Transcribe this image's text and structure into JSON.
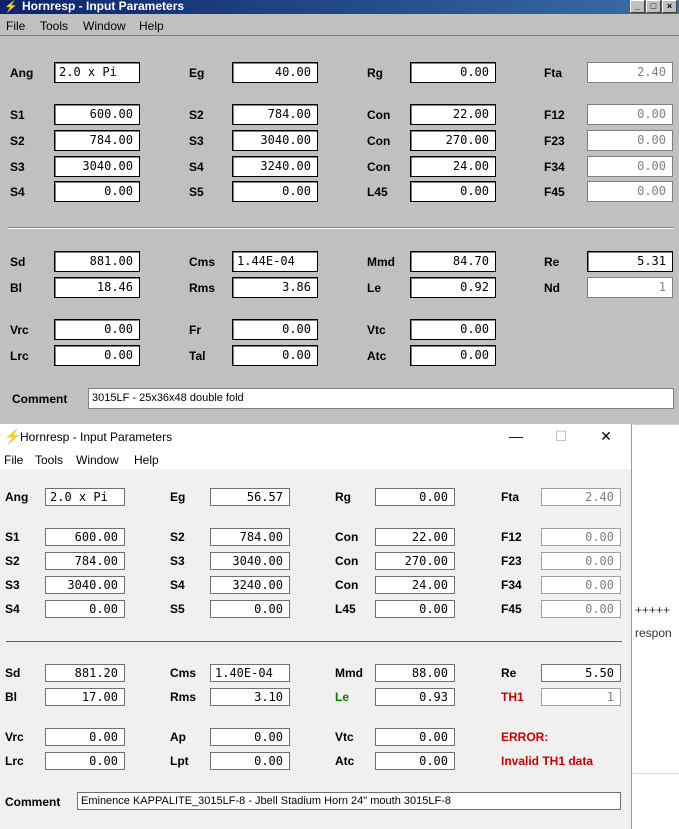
{
  "window1": {
    "title": "Hornresp - Input Parameters",
    "caption_buttons": [
      "_",
      "□",
      "×"
    ],
    "menu": [
      "File",
      "Tools",
      "Window",
      "Help"
    ],
    "fields": {
      "ang": {
        "label": "Ang",
        "value": "2.0 x Pi"
      },
      "eg": {
        "label": "Eg",
        "value": "40.00"
      },
      "rg": {
        "label": "Rg",
        "value": "0.00"
      },
      "fta": {
        "label": "Fta",
        "value": "2.40"
      },
      "s1": {
        "label": "S1",
        "value": "600.00"
      },
      "s2a": {
        "label": "S2",
        "value": "784.00"
      },
      "con1": {
        "label": "Con",
        "value": "22.00"
      },
      "f12": {
        "label": "F12",
        "value": "0.00"
      },
      "s2b": {
        "label": "S2",
        "value": "784.00"
      },
      "s3a": {
        "label": "S3",
        "value": "3040.00"
      },
      "con2": {
        "label": "Con",
        "value": "270.00"
      },
      "f23": {
        "label": "F23",
        "value": "0.00"
      },
      "s3b": {
        "label": "S3",
        "value": "3040.00"
      },
      "s4a": {
        "label": "S4",
        "value": "3240.00"
      },
      "con3": {
        "label": "Con",
        "value": "24.00"
      },
      "f34": {
        "label": "F34",
        "value": "0.00"
      },
      "s4b": {
        "label": "S4",
        "value": "0.00"
      },
      "s5": {
        "label": "S5",
        "value": "0.00"
      },
      "l45": {
        "label": "L45",
        "value": "0.00"
      },
      "f45": {
        "label": "F45",
        "value": "0.00"
      },
      "sd": {
        "label": "Sd",
        "value": "881.00"
      },
      "cms": {
        "label": "Cms",
        "value": "1.44E-04"
      },
      "mmd": {
        "label": "Mmd",
        "value": "84.70"
      },
      "re": {
        "label": "Re",
        "value": "5.31"
      },
      "bl": {
        "label": "Bl",
        "value": "18.46"
      },
      "rms": {
        "label": "Rms",
        "value": "3.86"
      },
      "le": {
        "label": "Le",
        "value": "0.92"
      },
      "nd": {
        "label": "Nd",
        "value": "1"
      },
      "vrc": {
        "label": "Vrc",
        "value": "0.00"
      },
      "fr": {
        "label": "Fr",
        "value": "0.00"
      },
      "vtc": {
        "label": "Vtc",
        "value": "0.00"
      },
      "lrc": {
        "label": "Lrc",
        "value": "0.00"
      },
      "tal": {
        "label": "Tal",
        "value": "0.00"
      },
      "atc": {
        "label": "Atc",
        "value": "0.00"
      }
    },
    "comment": {
      "label": "Comment",
      "value": "3015LF - 25x36x48 double fold"
    }
  },
  "window2": {
    "title": "Hornresp - Input Parameters",
    "caption_buttons": [
      "—",
      "☐",
      "✕"
    ],
    "menu": [
      "File",
      "Tools",
      "Window",
      "Help"
    ],
    "fields": {
      "ang": {
        "label": "Ang",
        "value": "2.0 x Pi"
      },
      "eg": {
        "label": "Eg",
        "value": "56.57"
      },
      "rg": {
        "label": "Rg",
        "value": "0.00"
      },
      "fta": {
        "label": "Fta",
        "value": "2.40"
      },
      "s1": {
        "label": "S1",
        "value": "600.00"
      },
      "s2a": {
        "label": "S2",
        "value": "784.00"
      },
      "con1": {
        "label": "Con",
        "value": "22.00"
      },
      "f12": {
        "label": "F12",
        "value": "0.00"
      },
      "s2b": {
        "label": "S2",
        "value": "784.00"
      },
      "s3a": {
        "label": "S3",
        "value": "3040.00"
      },
      "con2": {
        "label": "Con",
        "value": "270.00"
      },
      "f23": {
        "label": "F23",
        "value": "0.00"
      },
      "s3b": {
        "label": "S3",
        "value": "3040.00"
      },
      "s4a": {
        "label": "S4",
        "value": "3240.00"
      },
      "con3": {
        "label": "Con",
        "value": "24.00"
      },
      "f34": {
        "label": "F34",
        "value": "0.00"
      },
      "s4b": {
        "label": "S4",
        "value": "0.00"
      },
      "s5": {
        "label": "S5",
        "value": "0.00"
      },
      "l45": {
        "label": "L45",
        "value": "0.00"
      },
      "f45": {
        "label": "F45",
        "value": "0.00"
      },
      "sd": {
        "label": "Sd",
        "value": "881.20"
      },
      "cms": {
        "label": "Cms",
        "value": "1.40E-04"
      },
      "mmd": {
        "label": "Mmd",
        "value": "88.00"
      },
      "re": {
        "label": "Re",
        "value": "5.50"
      },
      "bl": {
        "label": "Bl",
        "value": "17.00"
      },
      "rms": {
        "label": "Rms",
        "value": "3.10"
      },
      "le": {
        "label": "Le",
        "value": "0.93"
      },
      "th1": {
        "label": "TH1",
        "value": "1"
      },
      "vrc": {
        "label": "Vrc",
        "value": "0.00"
      },
      "ap": {
        "label": "Ap",
        "value": "0.00"
      },
      "vtc": {
        "label": "Vtc",
        "value": "0.00"
      },
      "lrc": {
        "label": "Lrc",
        "value": "0.00"
      },
      "lpt": {
        "label": "Lpt",
        "value": "0.00"
      },
      "atc": {
        "label": "Atc",
        "value": "0.00"
      }
    },
    "error_title": "ERROR:",
    "error_message": "Invalid TH1 data",
    "comment": {
      "label": "Comment",
      "value": "Eminence KAPPALITE_3015LF-8 - Jbell Stadium Horn 24\" mouth 3015LF-8"
    }
  },
  "background": {
    "text_line1": "+++++",
    "text_line2": "respon"
  },
  "colors": {
    "classic_title": "#0a246a",
    "classic_face": "#c0c0c0",
    "modern_face": "#f0f0f0",
    "label_green": "#008000",
    "label_red": "#cc0000",
    "icon_yellow": "#e5b800"
  }
}
